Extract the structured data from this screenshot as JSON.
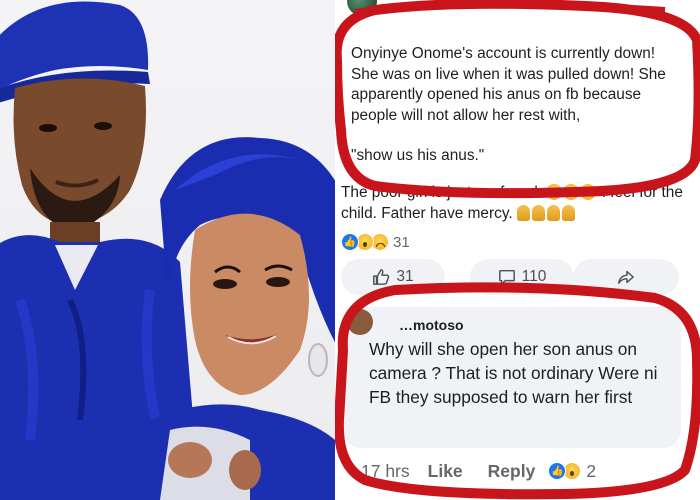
{
  "post": {
    "lines": [
      "Onyinye Onome's account is currently down! She was on live when it was pulled down! She apparently opened his anus on fb because people will not allow her rest with,",
      "\"show us his anus.\""
    ]
  },
  "followup": {
    "text_before_emoji": "The poor girl is just confused.",
    "text_after_emoji": "I feel for the child. Father have mercy."
  },
  "reactions": {
    "count": "31"
  },
  "actions": {
    "like_count": "31",
    "comment_count": "110"
  },
  "reply": {
    "author": "…motoso",
    "text": "Why will she open her son anus on camera ? That is not ordinary Were ni FB they supposed to warn her first",
    "time": "17 hrs",
    "like_label": "Like",
    "reply_label": "Reply",
    "reaction_count": "2"
  },
  "colors": {
    "agbada_blue": "#1c2fb0",
    "marker_red": "#c8141b",
    "facebook_blue": "#1877f2",
    "bubble_gray": "#f0f2f5"
  },
  "icons": [
    "thumbs-up-icon",
    "comment-icon",
    "share-icon",
    "like-reaction-icon",
    "wow-reaction-icon",
    "sad-reaction-icon",
    "crying-emoji-icon",
    "praying-hands-icon"
  ]
}
